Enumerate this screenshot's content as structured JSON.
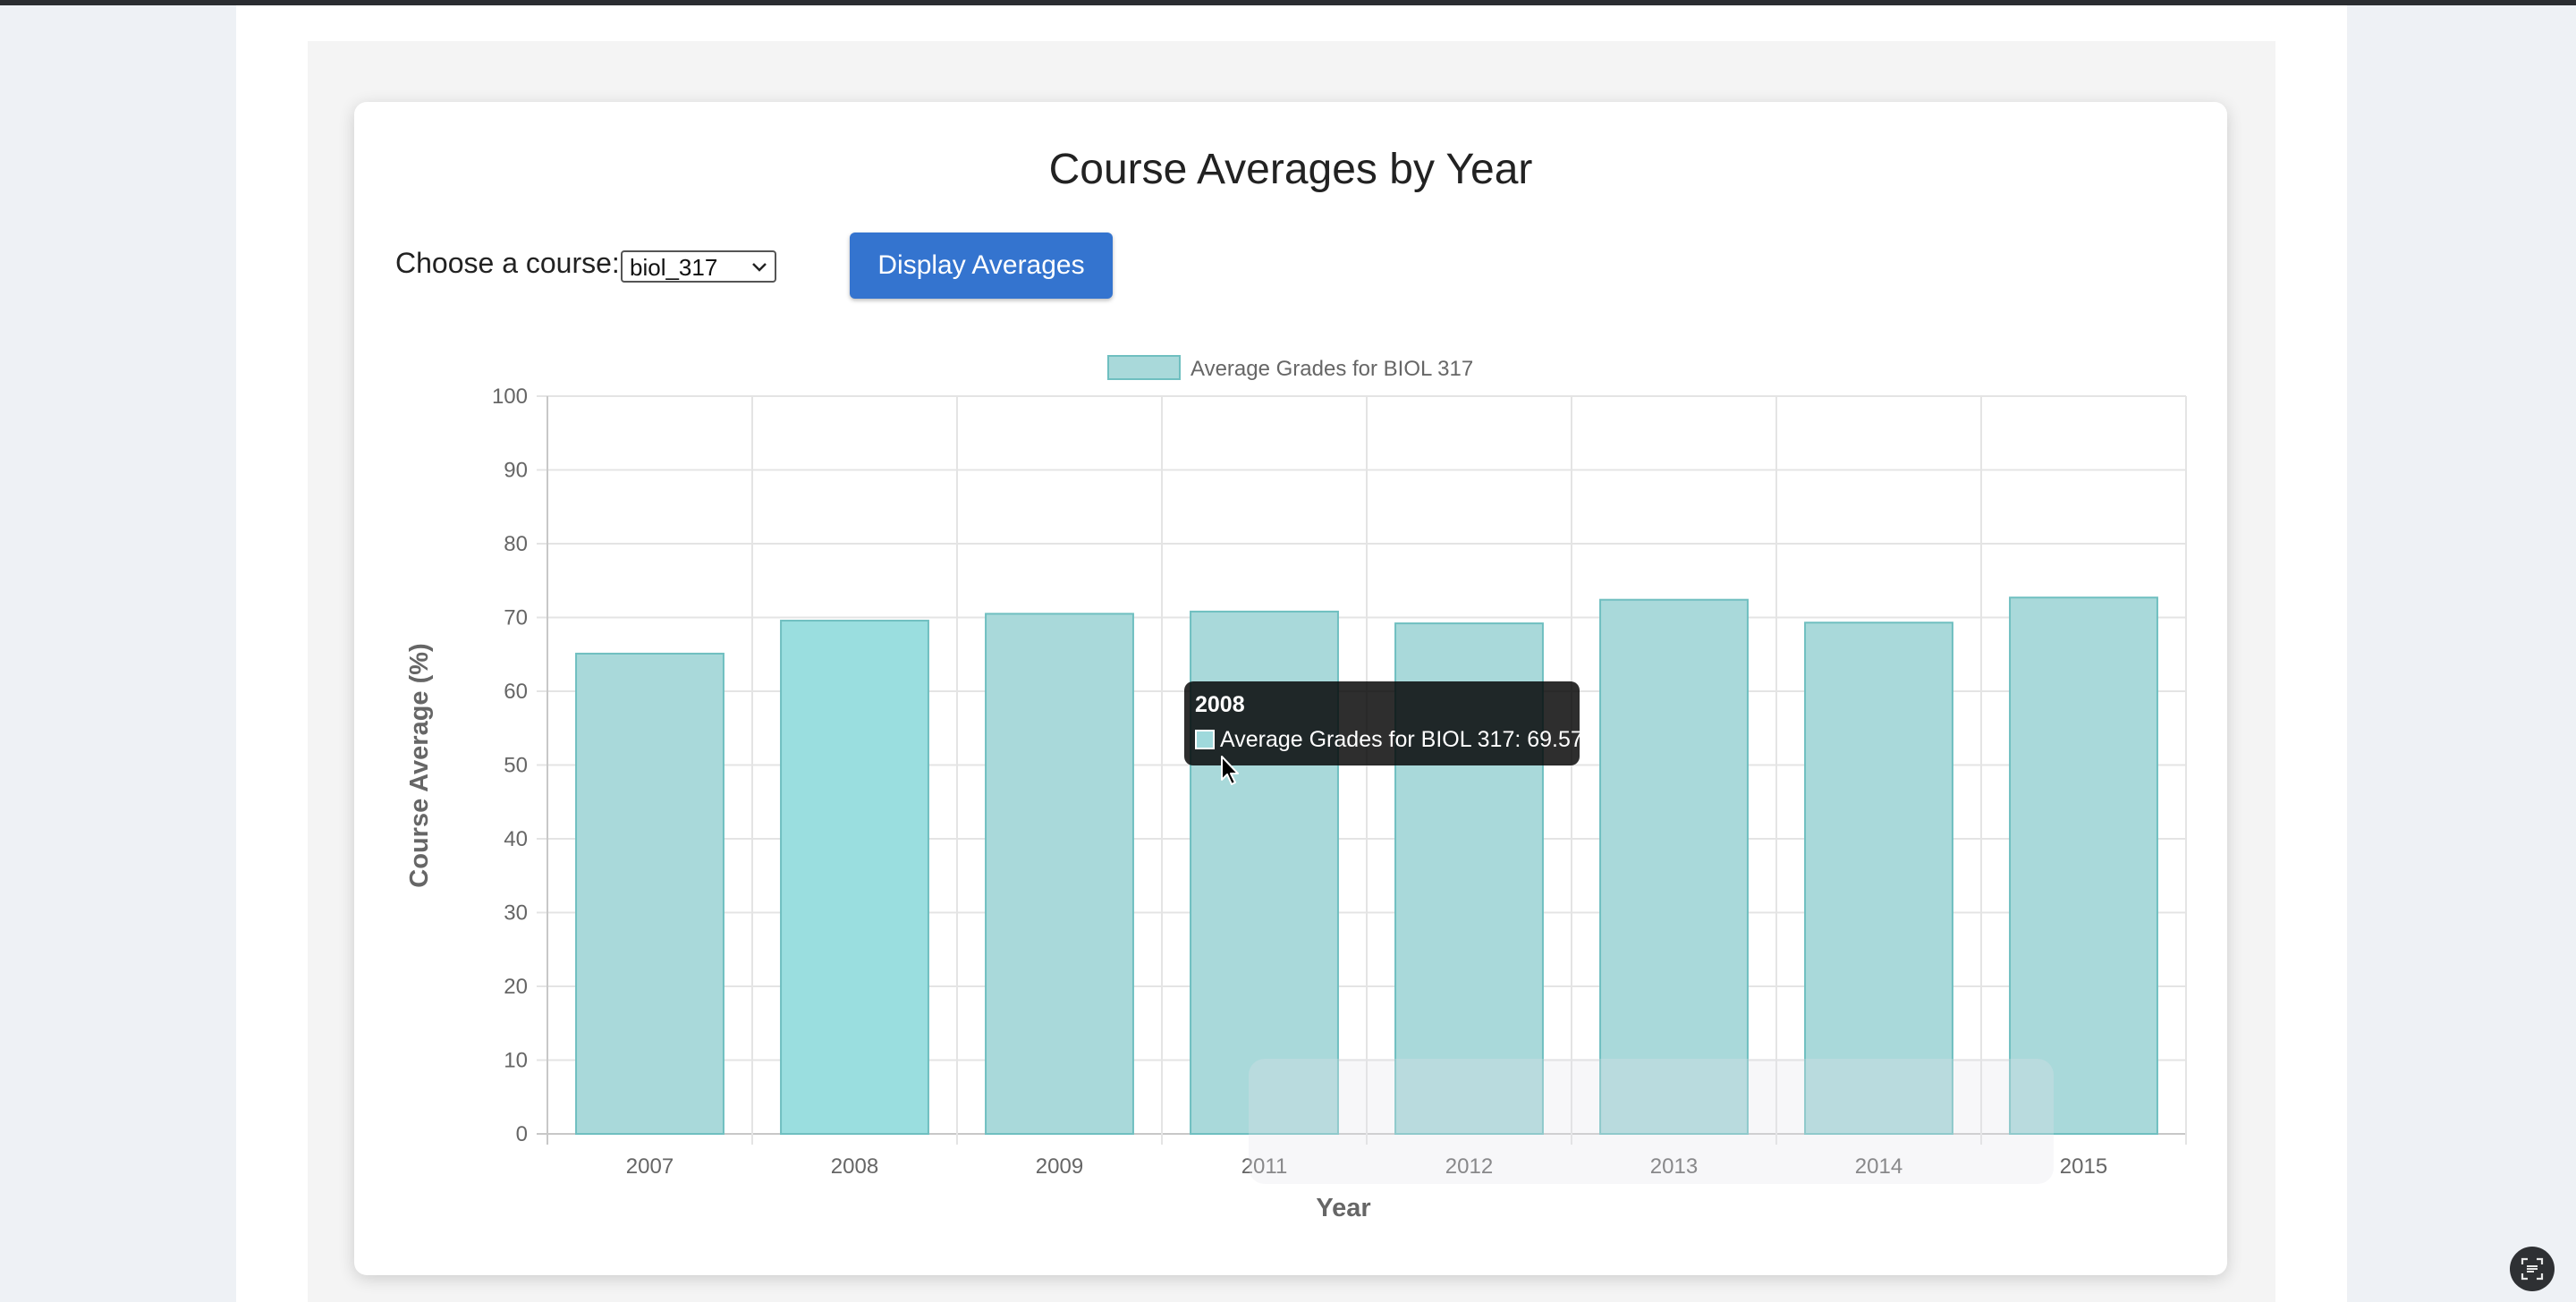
{
  "header": {
    "title": "Course Averages by Year"
  },
  "controls": {
    "course_label": "Choose a course:",
    "course_select_value": "biol_317",
    "display_button_label": "Display Averages"
  },
  "chart_data": {
    "type": "bar",
    "categories": [
      "2007",
      "2008",
      "2009",
      "2011",
      "2012",
      "2013",
      "2014",
      "2015"
    ],
    "series": [
      {
        "name": "Average Grades for BIOL 317",
        "values": [
          65.1,
          69.57,
          70.5,
          70.8,
          69.2,
          72.4,
          69.3,
          72.7
        ]
      }
    ],
    "xlabel": "Year",
    "ylabel": "Course Average (%)",
    "ylim": [
      0,
      100
    ],
    "yticks": [
      0,
      10,
      20,
      30,
      40,
      50,
      60,
      70,
      80,
      90,
      100
    ],
    "grid": true,
    "legend_position": "top",
    "colors": {
      "bar_fill": "#a9d9da",
      "bar_hover_fill": "#9adedf",
      "bar_border": "#6fbfc0"
    }
  },
  "tooltip": {
    "title": "2008",
    "label": "Average Grades for BIOL 317: 69.57",
    "swatch_color": "#9fd9dc",
    "hovered_category": "2008"
  },
  "colors": {
    "accent": "#3474cf"
  },
  "icons": {
    "cursor": "arrow-cursor-icon",
    "scan": "scan-text-icon",
    "select_arrow": "chevron-down-icon"
  }
}
